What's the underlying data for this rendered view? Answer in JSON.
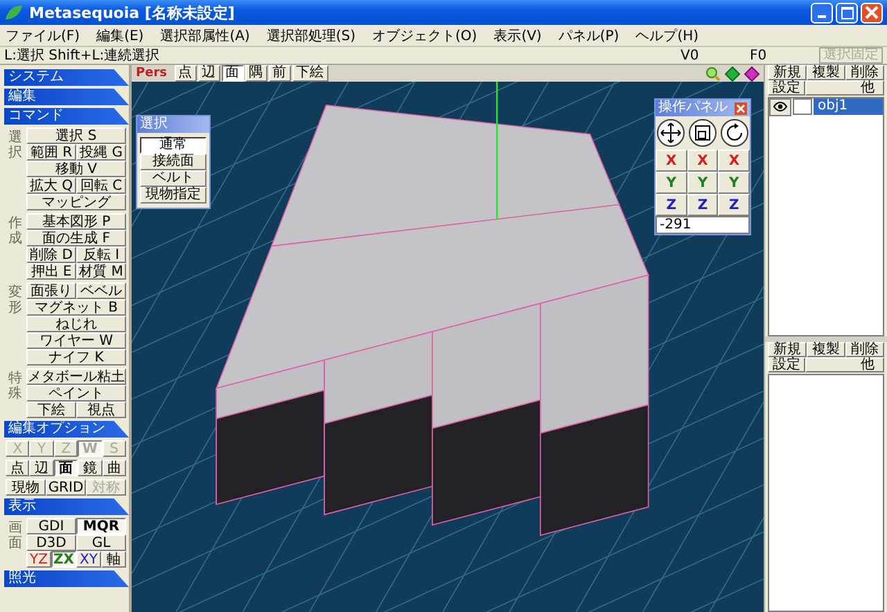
{
  "window": {
    "title": "Metasequoia [名称未設定]"
  },
  "menu": [
    "ファイル(F)",
    "編集(E)",
    "選択部属性(A)",
    "選択部処理(S)",
    "オブジェクト(O)",
    "表示(V)",
    "パネル(P)",
    "ヘルプ(H)"
  ],
  "status": {
    "hint": "L:選択 Shift+L:連続選択",
    "vertices": "V0",
    "faces": "F0",
    "lock_button": {
      "label": "選択固定",
      "disabled": true
    }
  },
  "sections": [
    {
      "title": "システム"
    },
    {
      "title": "編集"
    },
    {
      "title": "コマンド",
      "kind": "buttons",
      "groups": [
        {
          "label": "選択",
          "rows": [
            [
              {
                "label": "選択 S"
              }
            ],
            [
              {
                "label": "範囲 R"
              },
              {
                "label": "投縄 G"
              }
            ],
            [
              {
                "label": "移動 V"
              }
            ],
            [
              {
                "label": "拡大 Q"
              },
              {
                "label": "回転 C"
              }
            ],
            [
              {
                "label": "マッピング"
              }
            ]
          ]
        },
        {
          "label": "作成",
          "rows": [
            [
              {
                "label": "基本図形 P"
              }
            ],
            [
              {
                "label": "面の生成 F"
              }
            ],
            [
              {
                "label": "削除 D"
              },
              {
                "label": "反転 I"
              }
            ],
            [
              {
                "label": "押出 E"
              },
              {
                "label": "材質 M"
              }
            ]
          ]
        },
        {
          "label": "変形",
          "rows": [
            [
              {
                "label": "面張り"
              },
              {
                "label": "ベベル"
              }
            ],
            [
              {
                "label": "マグネット B"
              }
            ],
            [
              {
                "label": "ねじれ"
              }
            ],
            [
              {
                "label": "ワイヤー W"
              }
            ],
            [
              {
                "label": "ナイフ K"
              }
            ]
          ]
        },
        {
          "label": "特殊",
          "rows": [
            [
              {
                "label": "メタボール粘土"
              }
            ],
            [
              {
                "label": "ペイント"
              }
            ],
            [
              {
                "label": "下絵"
              },
              {
                "label": "視点"
              }
            ]
          ]
        }
      ]
    },
    {
      "title": "編集オプション",
      "kind": "buttons",
      "groups": [
        {
          "rows": [
            [
              {
                "label": "X",
                "selected": false,
                "disabled": true
              },
              {
                "label": "Y",
                "selected": false,
                "disabled": true
              },
              {
                "label": "Z",
                "selected": false,
                "disabled": true
              },
              {
                "label": "W",
                "selected": true,
                "disabled": true
              },
              {
                "label": "S",
                "selected": false,
                "disabled": true
              }
            ]
          ]
        },
        {
          "rows": [
            [
              {
                "label": "点",
                "selected": false,
                "disabled": false
              },
              {
                "label": "辺",
                "selected": false,
                "disabled": false
              },
              {
                "label": "面",
                "selected": true,
                "disabled": false
              },
              {
                "label": "鏡",
                "selected": false,
                "disabled": false
              },
              {
                "label": "曲",
                "selected": false,
                "disabled": false
              }
            ]
          ]
        },
        {
          "rows": [
            [
              {
                "label": "現物",
                "selected": false,
                "disabled": false
              },
              {
                "label": "GRID",
                "selected": false,
                "disabled": false
              },
              {
                "label": "対称",
                "selected": false,
                "disabled": true
              }
            ]
          ]
        }
      ]
    },
    {
      "title": "表示",
      "kind": "buttons",
      "groups": [
        {
          "label": "画面",
          "rows": [
            [
              {
                "label": "GDI",
                "selected": false
              },
              {
                "label": "MQR",
                "selected": true
              }
            ],
            [
              {
                "label": "D3D",
                "selected": false
              },
              {
                "label": "GL",
                "selected": false
              }
            ],
            [
              {
                "label": "YZ",
                "selected": false,
                "color": "#d02020"
              },
              {
                "label": "ZX",
                "selected": true,
                "color": "#208020"
              },
              {
                "label": "XY",
                "selected": false,
                "color": "#2020c0"
              },
              {
                "label": "軸",
                "selected": false
              }
            ]
          ]
        }
      ]
    },
    {
      "title": "照光"
    }
  ],
  "viewport": {
    "projection": "Pers",
    "modes": [
      {
        "label": "点",
        "selected": false
      },
      {
        "label": "辺",
        "selected": false
      },
      {
        "label": "面",
        "selected": true
      },
      {
        "label": "隅",
        "selected": false
      },
      {
        "label": "前",
        "selected": false
      },
      {
        "label": "下絵",
        "selected": false
      }
    ]
  },
  "select_panel": {
    "title": "選択",
    "options": [
      {
        "label": "通常",
        "selected": true
      },
      {
        "label": "接続面",
        "selected": false
      },
      {
        "label": "ベルト",
        "selected": false
      },
      {
        "label": "現物指定",
        "selected": false
      }
    ]
  },
  "operation_panel": {
    "title": "操作パネル",
    "tools": [
      {
        "kind": "move",
        "selected": false
      },
      {
        "kind": "scale",
        "selected": false
      },
      {
        "kind": "rotate",
        "selected": false
      }
    ],
    "axes": [
      [
        {
          "label": "X",
          "color": "#d02020"
        },
        {
          "label": "X",
          "color": "#d02020"
        },
        {
          "label": "X",
          "color": "#d02020"
        }
      ],
      [
        {
          "label": "Y",
          "color": "#208020"
        },
        {
          "label": "Y",
          "color": "#208020"
        },
        {
          "label": "Y",
          "color": "#208020"
        }
      ],
      [
        {
          "label": "Z",
          "color": "#2020c0"
        },
        {
          "label": "Z",
          "color": "#2020c0"
        },
        {
          "label": "Z",
          "color": "#2020c0"
        }
      ]
    ],
    "value": "-291"
  },
  "object_panel": {
    "buttons": [
      "新規",
      "複製",
      "削除"
    ],
    "settings": "設定",
    "other": "他",
    "items": [
      {
        "name": "obj1",
        "visible": true,
        "locked": false,
        "selected": true
      }
    ]
  },
  "material_panel": {
    "buttons": [
      "新規",
      "複製",
      "削除"
    ],
    "settings": "設定",
    "other": "他"
  }
}
